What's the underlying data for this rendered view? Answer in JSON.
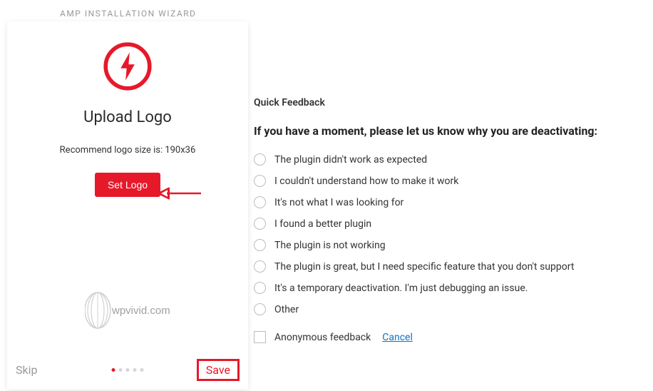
{
  "wizard": {
    "header": "AMP INSTALLATION WIZARD",
    "title": "Upload Logo",
    "recommend": "Recommend logo size is: 190x36",
    "set_logo_btn": "Set Logo",
    "preview_logo_text": "wpvivid.com",
    "skip": "Skip",
    "save": "Save",
    "active_dot": 0,
    "dot_count": 5
  },
  "feedback": {
    "header": "Quick Feedback",
    "question": "If you have a moment, please let us know why you are deactivating:",
    "options": [
      "The plugin didn't work as expected",
      "I couldn't understand how to make it work",
      "It's not what I was looking for",
      "I found a better plugin",
      "The plugin is not working",
      "The plugin is great, but I need specific feature that you don't support",
      "It's a temporary deactivation. I'm just debugging an issue.",
      "Other"
    ],
    "anonymous": "Anonymous feedback",
    "cancel": "Cancel"
  }
}
